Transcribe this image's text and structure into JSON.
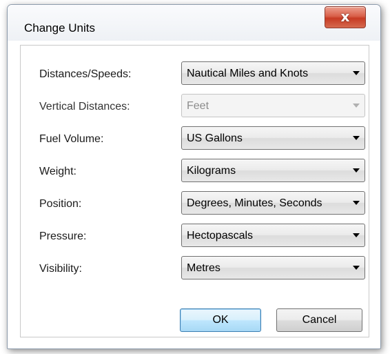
{
  "window": {
    "title": "Change Units",
    "close_glyph": "x"
  },
  "fields": [
    {
      "label": "Distances/Speeds:",
      "value": "Nautical Miles and Knots",
      "enabled": true
    },
    {
      "label": "Vertical Distances:",
      "value": "Feet",
      "enabled": false
    },
    {
      "label": "Fuel Volume:",
      "value": "US Gallons",
      "enabled": true
    },
    {
      "label": "Weight:",
      "value": "Kilograms",
      "enabled": true
    },
    {
      "label": "Position:",
      "value": "Degrees, Minutes, Seconds",
      "enabled": true
    },
    {
      "label": "Pressure:",
      "value": "Hectopascals",
      "enabled": true
    },
    {
      "label": "Visibility:",
      "value": "Metres",
      "enabled": true
    }
  ],
  "buttons": {
    "ok_label": "OK",
    "cancel_label": "Cancel"
  },
  "icons": {
    "close": "close-icon",
    "dropdown": "chevron-down-icon"
  },
  "colors": {
    "close_button": "#c73b24",
    "default_button_border": "#3c7fb1",
    "disabled_text": "#8c8c8c"
  }
}
